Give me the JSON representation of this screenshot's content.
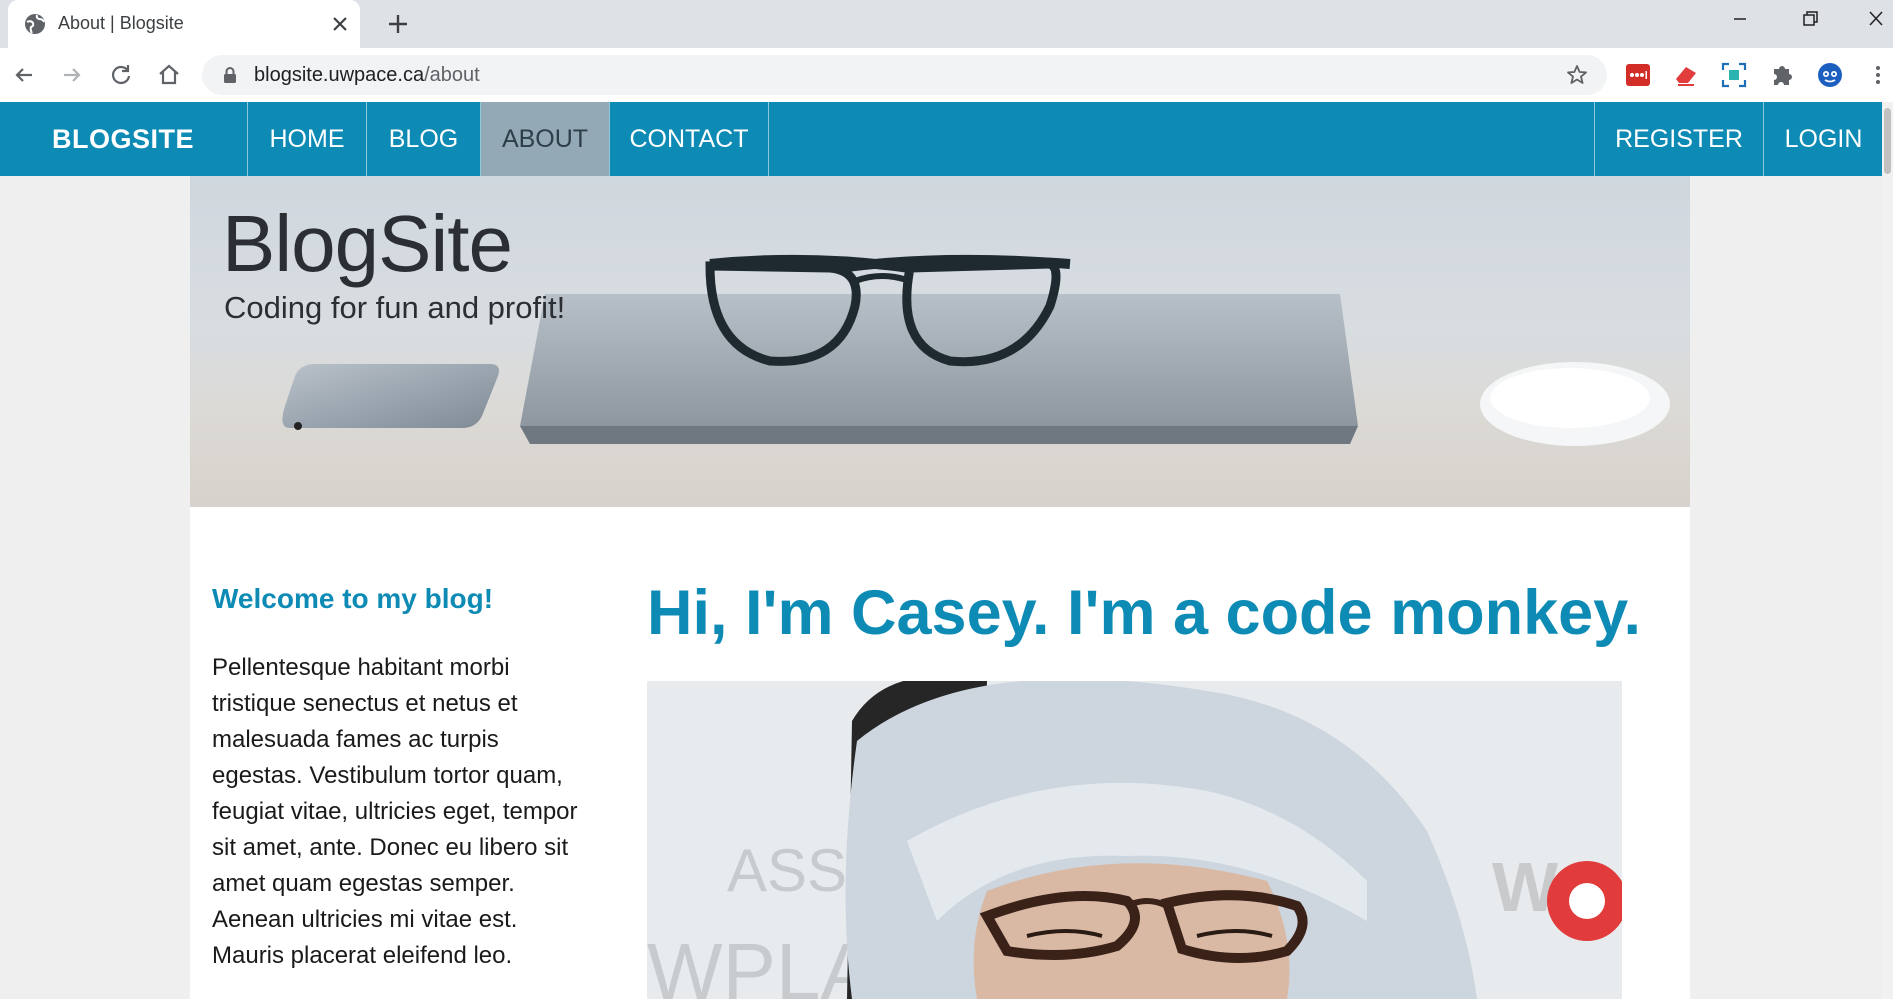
{
  "browser": {
    "tab": {
      "title": "About | Blogsite"
    },
    "address": {
      "host": "blogsite.uwpace.ca",
      "path": "/about"
    }
  },
  "site": {
    "brand": "BLOGSITE",
    "nav": {
      "home": "HOME",
      "blog": "BLOG",
      "about": "ABOUT",
      "contact": "CONTACT",
      "register": "REGISTER",
      "login": "LOGIN",
      "active": "ABOUT"
    },
    "banner": {
      "title": "BlogSite",
      "tagline": "Coding for fun and profit!"
    },
    "sidebar": {
      "heading": "Welcome to my blog!",
      "text": "Pellentesque habitant morbi tristique senectus et netus et malesuada fames ac turpis egestas. Vestibulum tortor quam, feugiat vitae, ultricies eget, tempor sit amet, ante. Donec eu libero sit amet quam egestas semper. Aenean ultricies mi vitae est. Mauris placerat eleifend leo."
    },
    "main": {
      "heading": "Hi, I'm Casey. I'm a code monkey."
    },
    "photo_backdrop_text": {
      "line1": "ASS",
      "line2": "WPLA",
      "line3": "W"
    }
  },
  "colors": {
    "accent": "#0e8bb5",
    "nav_active_bg": "#93a9b6",
    "page_bg": "#efefef"
  }
}
